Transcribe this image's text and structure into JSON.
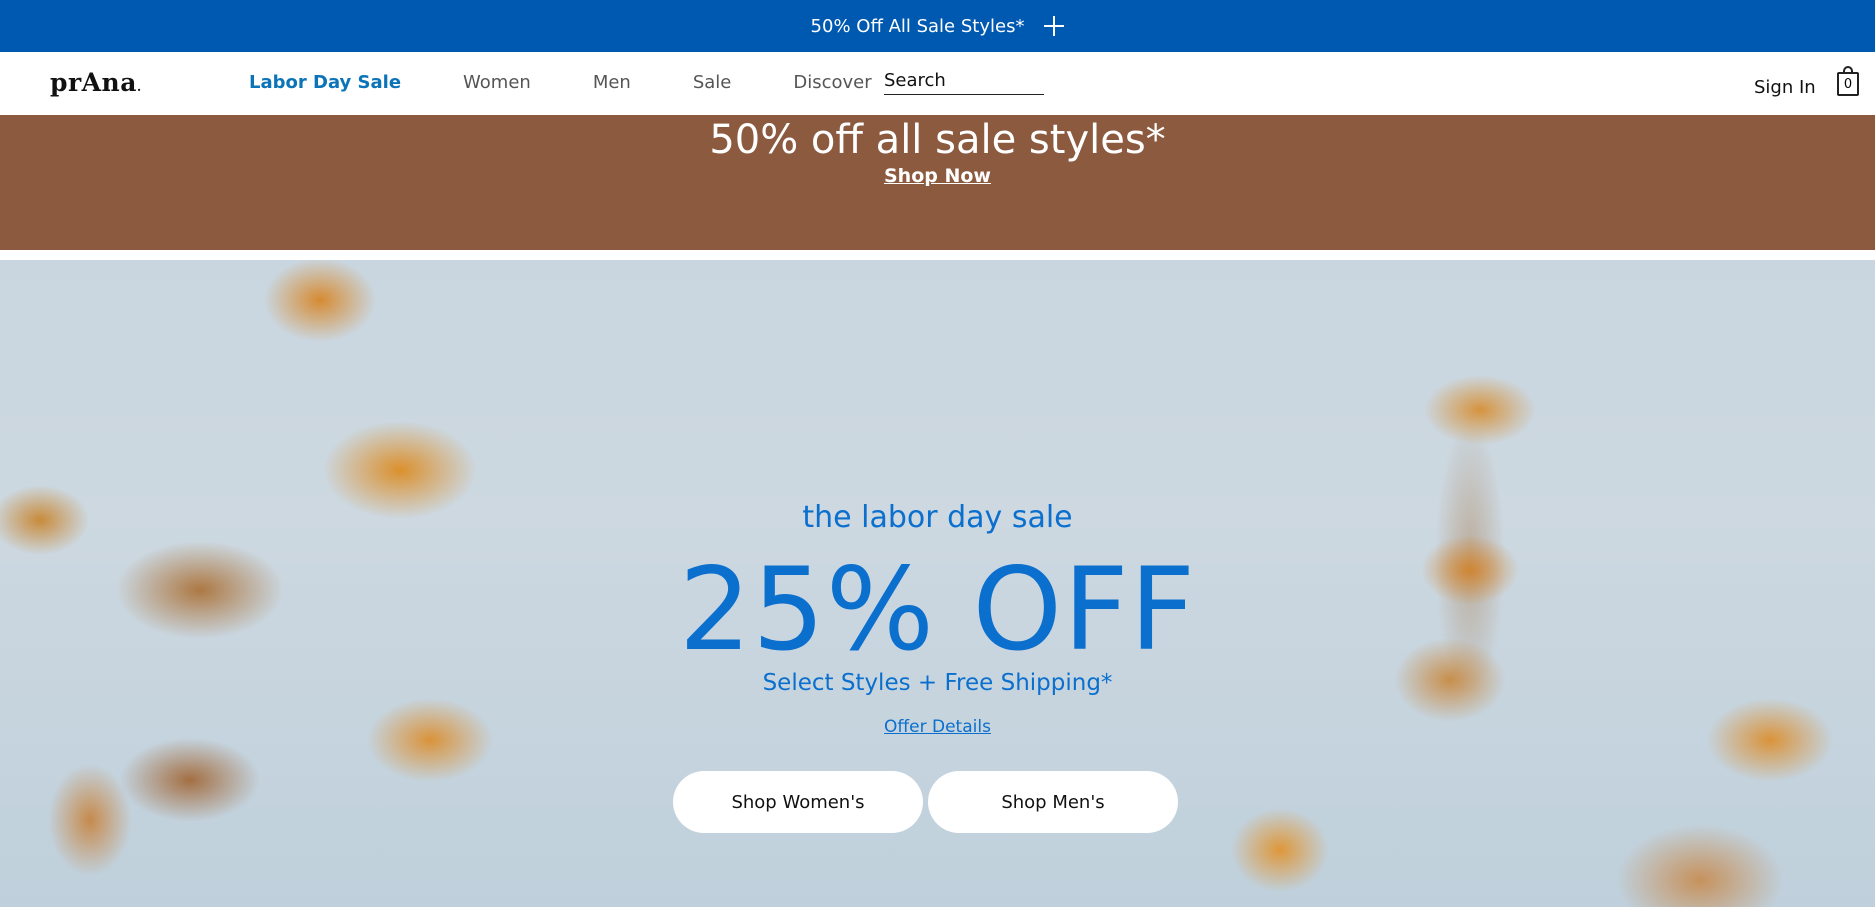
{
  "promo_bar": {
    "text": "50% Off All Sale Styles*",
    "expand_icon": "plus-icon"
  },
  "header": {
    "logo": "prAna",
    "logo_dot": ".",
    "nav": [
      {
        "label": "Labor Day Sale",
        "active": true
      },
      {
        "label": "Women",
        "active": false
      },
      {
        "label": "Men",
        "active": false
      },
      {
        "label": "Sale",
        "active": false
      },
      {
        "label": "Discover",
        "active": false
      }
    ],
    "search": {
      "placeholder": "Search",
      "value": ""
    },
    "sign_in": "Sign In",
    "cart_count": "0",
    "cart_icon": "shopping-bag-icon"
  },
  "sale_banner": {
    "headline": "50% off all sale styles*",
    "cta": "Shop Now",
    "background": "#8b5a3f"
  },
  "hero": {
    "eyebrow": "the labor day sale",
    "headline": "25% OFF",
    "subheadline": "Select Styles + Free Shipping*",
    "offer_link": "Offer Details",
    "buttons": [
      "Shop Women's",
      "Shop Men's"
    ],
    "accent_color": "#0b6fce"
  },
  "colors": {
    "promo_bar": "#0059b0",
    "nav_active": "#0b73b8"
  }
}
